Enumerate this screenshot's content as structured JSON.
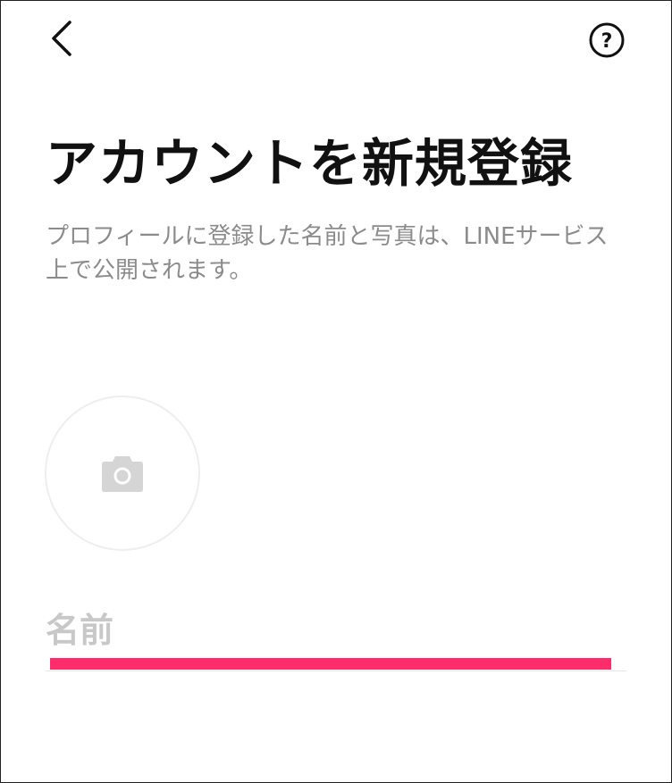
{
  "header": {
    "back_icon": "chevron-left-icon",
    "help_icon": "question-circle-icon",
    "help_glyph": "?"
  },
  "main": {
    "title": "アカウントを新規登録",
    "description": "プロフィールに登録した名前と写真は、LINEサービス上で公開されます。"
  },
  "avatar": {
    "icon": "camera-icon"
  },
  "name_field": {
    "label": "名前",
    "value": "",
    "placeholder": ""
  },
  "colors": {
    "highlight": "#ff2d6b",
    "placeholder_gray": "#c8c8c8",
    "text_dark": "#111111"
  }
}
